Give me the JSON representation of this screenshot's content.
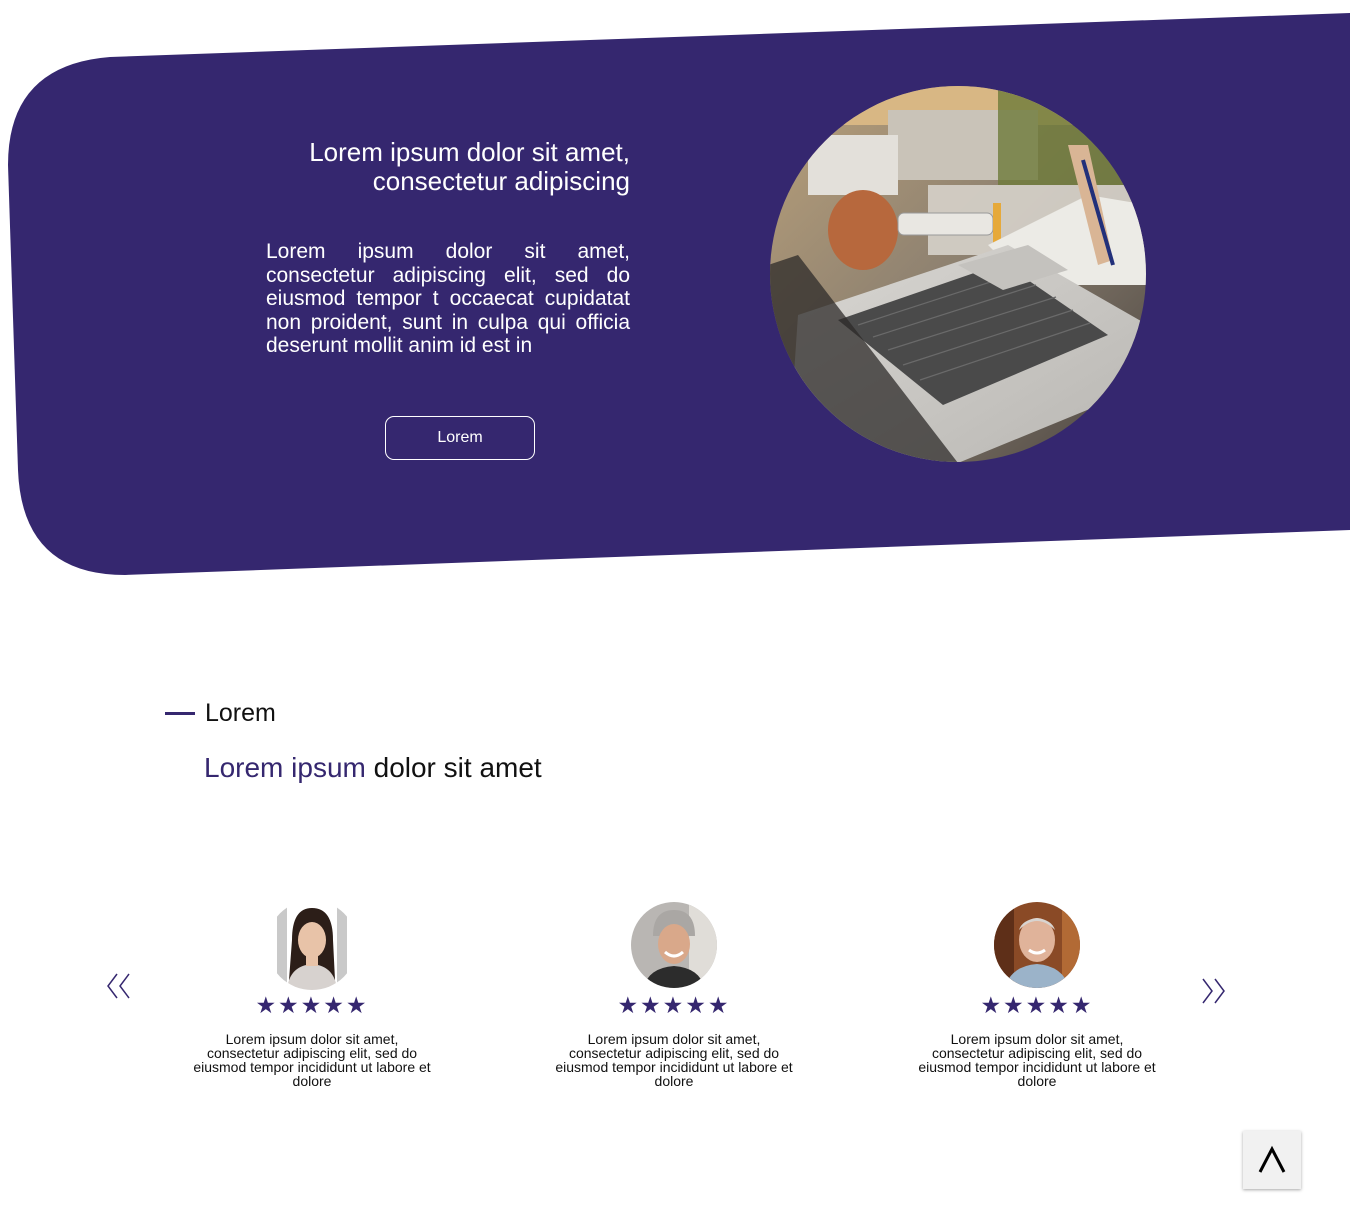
{
  "colors": {
    "brand": "#35276f",
    "hero_text": "#ffffff",
    "body_text": "#111111"
  },
  "hero": {
    "title_line1": "Lorem ipsum dolor sit amet,",
    "title_line2": "consectetur adipiscing",
    "body": "Lorem ipsum dolor sit amet, consectetur adipiscing elit, sed do eiusmod tempor t occaecat cupidatat non proident, sunt in culpa qui officia deserunt mollit anim id est in",
    "button_label": "Lorem",
    "image_icon": "laptop-photo"
  },
  "section": {
    "kicker": "Lorem",
    "heading_accent": "Lorem ipsum",
    "heading_rest": " dolor sit amet"
  },
  "carousel": {
    "prev_icon": "double-chevron-left-icon",
    "next_icon": "double-chevron-right-icon",
    "testimonials": [
      {
        "avatar_icon": "woman-avatar",
        "stars": "★★★★★",
        "rating": 5,
        "text": "Lorem ipsum dolor sit amet, consectetur adipiscing elit, sed do eiusmod tempor incididunt ut labore et dolore"
      },
      {
        "avatar_icon": "man-gray-hair-avatar",
        "stars": "★★★★★",
        "rating": 5,
        "text": "Lorem ipsum dolor sit amet, consectetur adipiscing elit, sed do eiusmod tempor incididunt ut labore et dolore"
      },
      {
        "avatar_icon": "man-bald-avatar",
        "stars": "★★★★★",
        "rating": 5,
        "text": "Lorem ipsum dolor sit amet, consectetur adipiscing elit, sed do eiusmod tempor incididunt ut labore et dolore"
      }
    ]
  },
  "scroll_top": {
    "icon": "caret-up-icon"
  }
}
